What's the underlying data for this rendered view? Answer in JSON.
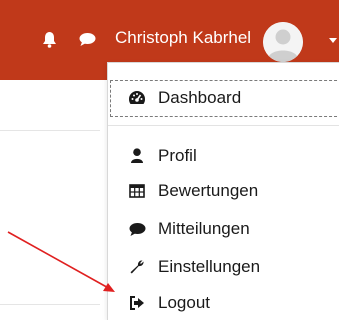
{
  "header": {
    "user_name": "Christoph Kabrhel",
    "bg_color": "#c0391a",
    "icons": [
      "bell-icon",
      "chat-bubble-icon",
      "chevron-down-icon"
    ]
  },
  "menu": {
    "items": [
      {
        "label": "Dashboard",
        "icon": "dashboard-gauge-icon"
      },
      {
        "label": "Profil",
        "icon": "user-icon"
      },
      {
        "label": "Bewertungen",
        "icon": "table-grid-icon"
      },
      {
        "label": "Mitteilungen",
        "icon": "chat-bubble-icon"
      },
      {
        "label": "Einstellungen",
        "icon": "wrench-icon"
      },
      {
        "label": "Logout",
        "icon": "sign-out-icon"
      }
    ]
  },
  "annotation": {
    "arrow_color": "#e02020"
  }
}
